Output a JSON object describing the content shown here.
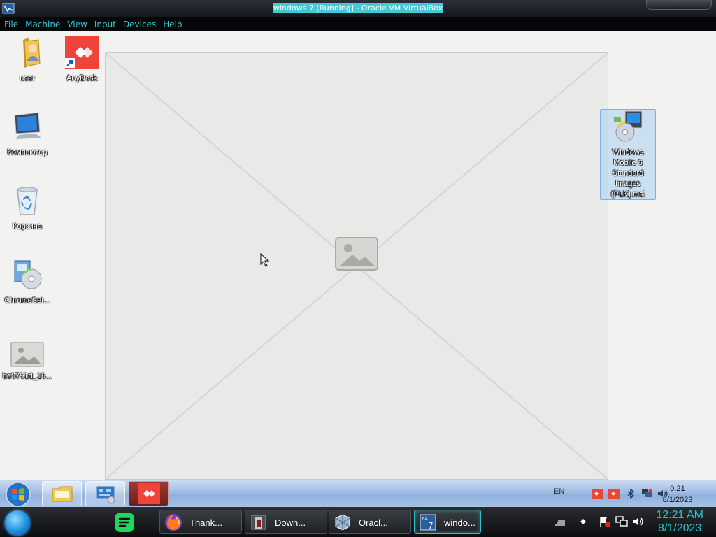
{
  "vm_window": {
    "title": "windows 7 [Running] - Oracle VM VirtualBox",
    "menu": [
      "File",
      "Machine",
      "View",
      "Input",
      "Devices",
      "Help"
    ]
  },
  "desktop": {
    "wallpaper_icon": "photo-placeholder",
    "icons": [
      {
        "label": "user",
        "icon": "user-folder-icon"
      },
      {
        "label": "AnyDesk",
        "icon": "anydesk-icon"
      },
      {
        "label": "Компьютер",
        "icon": "computer-icon"
      },
      {
        "label": "Корзина",
        "icon": "recycle-bin-icon"
      },
      {
        "label": "ChromeSet...",
        "icon": "installer-icon"
      },
      {
        "label": "be0791d_16...",
        "icon": "image-thumbnail-icon"
      },
      {
        "label": "Windows Mobile 6 Standard Images (PLK).msi",
        "icon": "msi-installer-icon",
        "selected": true
      }
    ]
  },
  "guest_taskbar": {
    "pinned": [
      "file-explorer-icon",
      "control-panel-icon",
      "anydesk-icon"
    ],
    "language": "EN",
    "tray_icons": [
      "anydesk-tray-icon",
      "anydesk-tray-icon",
      "bluetooth-icon",
      "network-icon",
      "volume-icon"
    ],
    "time": "0:21",
    "date": "8/1/2023"
  },
  "host_taskbar": {
    "buttons": [
      {
        "label": "Thank...",
        "icon": "firefox-icon"
      },
      {
        "label": "Down...",
        "icon": "window-app-icon"
      },
      {
        "label": "Oracl...",
        "icon": "virtualbox-icon"
      },
      {
        "label": "windo...",
        "icon": "vm-windows7-icon",
        "active": true
      }
    ],
    "time": "12:21 AM",
    "date": "8/1/2023"
  },
  "colors": {
    "menu_text": "#38c6d8",
    "title_highlight": "#44c9d6",
    "anydesk_red": "#ef443b",
    "host_clock": "#27c2d2"
  }
}
